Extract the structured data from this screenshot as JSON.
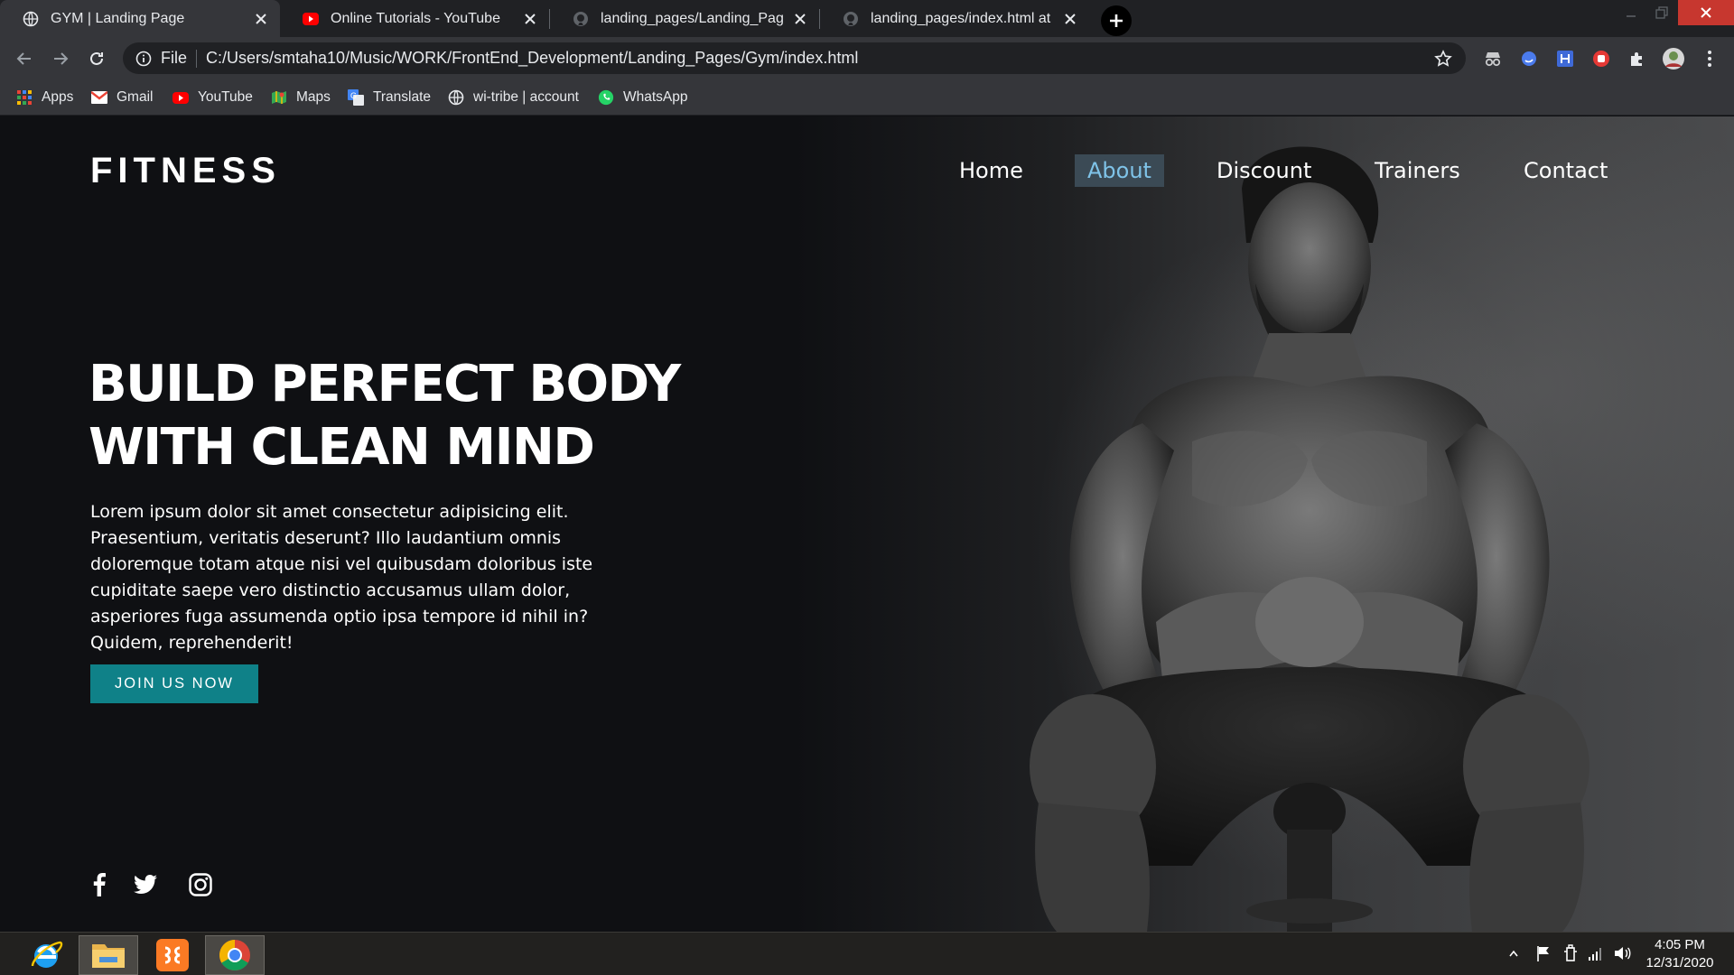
{
  "browser": {
    "tabs": [
      {
        "title": "GYM | Landing Page",
        "icon": "globe-icon",
        "active": true
      },
      {
        "title": "Online Tutorials - YouTube",
        "icon": "youtube-icon",
        "active": false
      },
      {
        "title": "landing_pages/Landing_Pages/G",
        "icon": "github-icon",
        "active": false
      },
      {
        "title": "landing_pages/index.html at mai",
        "icon": "github-icon",
        "active": false
      }
    ],
    "address": {
      "scheme_label": "File",
      "url": "C:/Users/smtaha10/Music/WORK/FrontEnd_Development/Landing_Pages/Gym/index.html"
    },
    "bookmarks": [
      {
        "label": "Apps",
        "icon": "apps-grid-icon"
      },
      {
        "label": "Gmail",
        "icon": "gmail-icon"
      },
      {
        "label": "YouTube",
        "icon": "youtube-icon"
      },
      {
        "label": "Maps",
        "icon": "maps-icon"
      },
      {
        "label": "Translate",
        "icon": "translate-icon"
      },
      {
        "label": "wi-tribe | account",
        "icon": "globe-icon"
      },
      {
        "label": "WhatsApp",
        "icon": "whatsapp-icon"
      }
    ],
    "extensions": [
      "incognito-extension-icon",
      "edge-extension-icon",
      "h-extension-icon",
      "stop-extension-icon",
      "puzzle-icon",
      "avatar"
    ]
  },
  "page": {
    "logo": "FITNESS",
    "nav": [
      {
        "label": "Home",
        "active": false
      },
      {
        "label": "About",
        "active": true
      },
      {
        "label": "Discount",
        "active": false
      },
      {
        "label": "Trainers",
        "active": false
      },
      {
        "label": "Contact",
        "active": false
      }
    ],
    "headline": [
      "BUILD PERFECT BODY",
      "WITH CLEAN MIND"
    ],
    "lead": "Lorem ipsum dolor sit amet consectetur adipisicing elit. Praesentium, veritatis deserunt? Illo laudantium omnis doloremque totam atque nisi vel quibusdam doloribus iste cupiditate saepe vero distinctio accusamus ullam dolor, asperiores fuga assumenda optio ipsa tempore id nihil in? Quidem, reprehenderit!",
    "cta": "JOIN US NOW",
    "social": [
      "facebook-icon",
      "twitter-icon",
      "instagram-icon"
    ],
    "colors": {
      "accent": "#0f8188",
      "active_nav_text": "#7fc3e8",
      "background": "#0f1013"
    }
  },
  "taskbar": {
    "apps": [
      "internet-explorer-icon",
      "file-explorer-icon",
      "xampp-icon",
      "chrome-icon"
    ],
    "time": "4:05 PM",
    "date": "12/31/2020"
  }
}
